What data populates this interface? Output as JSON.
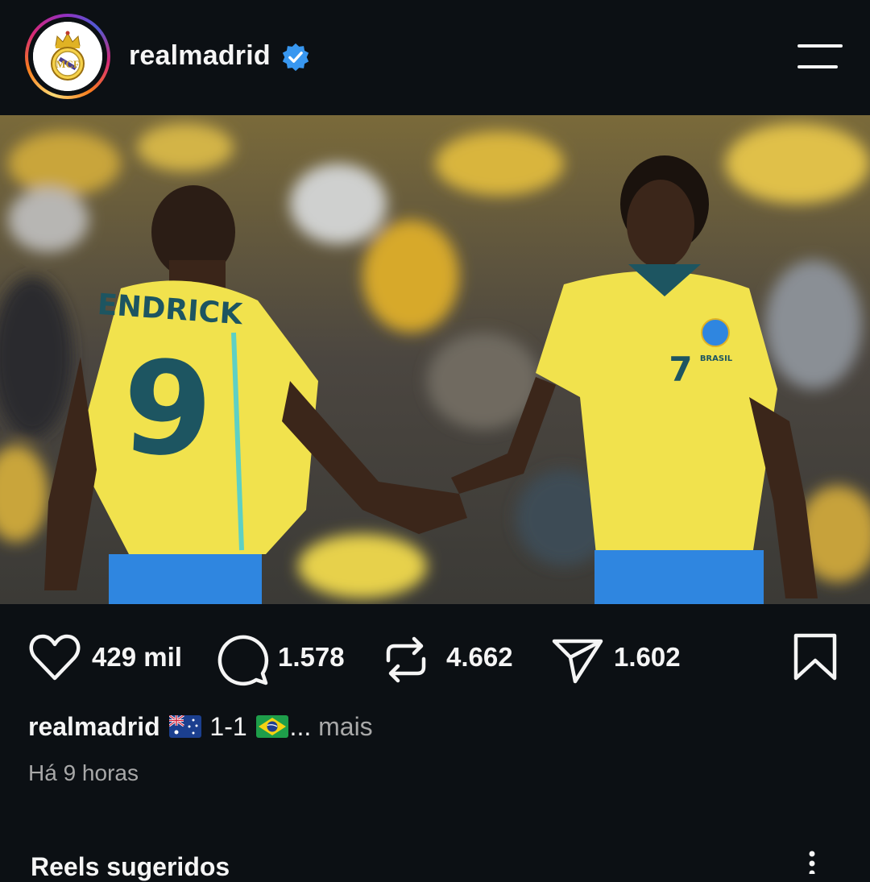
{
  "header": {
    "username": "realmadrid",
    "verified": true,
    "avatar_icon": "real-madrid-crest",
    "menu_icon": "menu-icon"
  },
  "post": {
    "image_description_icon": "photo",
    "tag_icon": "user-tag-icon",
    "actions": {
      "likes": "429 mil",
      "comments": "1.578",
      "reposts": "4.662",
      "shares": "1.602"
    },
    "caption": {
      "username": "realmadrid",
      "flag_1": "🇦🇺",
      "score": " 1-1 ",
      "flag_2": "🇧🇷",
      "ellipsis": "...",
      "more_label": " mais"
    },
    "timestamp": "Há 9 horas",
    "jersey_names": [
      "ENDRICK",
      "9",
      "7",
      "BRASIL"
    ]
  },
  "suggested": {
    "title": "Reels sugeridos"
  },
  "colors": {
    "background": "#0c1014",
    "verified_blue": "#3897f0",
    "secondary_text": "#a8a8a8",
    "jersey_yellow": "#f2e24a",
    "shorts_blue": "#2f86e0"
  }
}
